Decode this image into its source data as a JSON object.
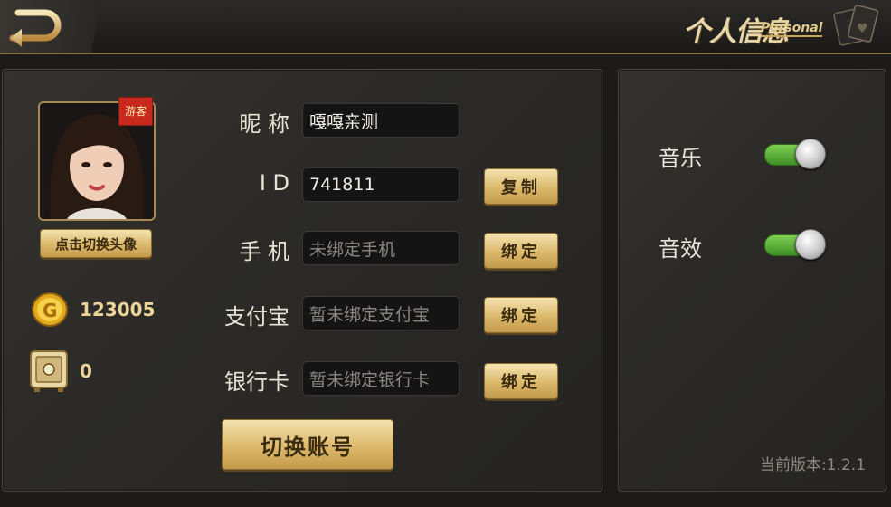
{
  "header": {
    "title_cn": "个人信息",
    "title_en": "Personal",
    "back_icon": "back-arrow-icon"
  },
  "profile": {
    "guest_badge": "游客",
    "switch_avatar_label": "点击切换头像",
    "coins": "123005",
    "safe_balance": "0"
  },
  "form": {
    "nickname_label": "昵 称",
    "nickname_value": "嘎嘎亲测",
    "id_label": "I D",
    "id_value": "741811",
    "copy_label": "复制",
    "phone_label": "手 机",
    "phone_placeholder": "未绑定手机",
    "alipay_label": "支付宝",
    "alipay_placeholder": "暂未绑定支付宝",
    "bankcard_label": "银行卡",
    "bankcard_placeholder": "暂未绑定银行卡",
    "bind_label": "绑定",
    "switch_account_label": "切换账号"
  },
  "settings": {
    "music_label": "音乐",
    "music_on": true,
    "sound_label": "音效",
    "sound_on": true,
    "version_text": "当前版本:1.2.1"
  },
  "colors": {
    "accent_gold": "#dcb86a",
    "toggle_green": "#5fb33a"
  }
}
